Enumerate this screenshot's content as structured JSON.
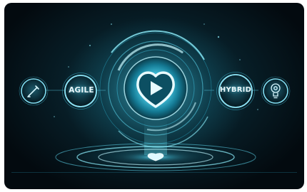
{
  "badges": {
    "left_label": "AGILE",
    "right_label": "HYBRID"
  },
  "icons": {
    "far_left": "pen-nib-icon",
    "center": "play-heart-icon",
    "far_right": "lightbulb-gear-icon",
    "platform": "play-heart-icon"
  },
  "colors": {
    "background": "#041219",
    "glow": "#5fe6ff",
    "ring": "#7fdcf0",
    "text": "#eaf8fb"
  }
}
